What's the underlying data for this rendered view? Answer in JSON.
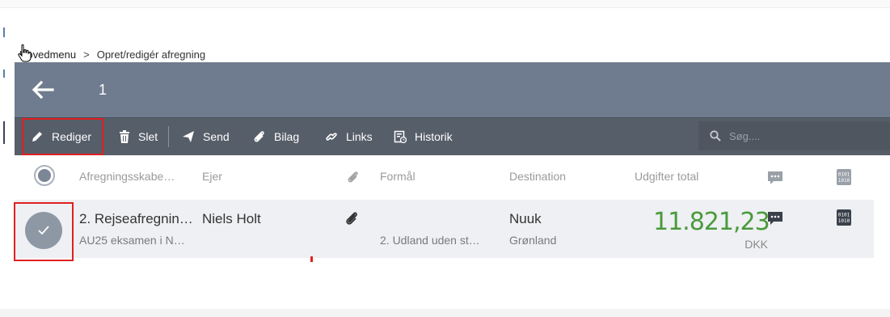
{
  "breadcrumb": {
    "home": "Hovedmenu",
    "separator": ">",
    "current": "Opret/redigér afregning"
  },
  "header": {
    "title": "1",
    "back_icon": "arrow-left-icon"
  },
  "toolbar": {
    "edit_label": "Rediger",
    "delete_label": "Slet",
    "send_label": "Send",
    "attachments_label": "Bilag",
    "links_label": "Links",
    "history_label": "Historik",
    "search_placeholder": "Søg...."
  },
  "columns": {
    "template": "Afregningsskabe…",
    "owner": "Ejer",
    "purpose": "Formål",
    "destination": "Destination",
    "total": "Udgifter total"
  },
  "row": {
    "name": "2. Rejseafregnin…",
    "subtitle": "AU25 eksamen i N…",
    "owner": "Niels Holt",
    "purpose": "2. Udland uden st…",
    "destination_city": "Nuuk",
    "destination_country": "Grønland",
    "amount": "11.821,23",
    "currency": "DKK"
  },
  "colors": {
    "header_bg": "#6f7b8e",
    "toolbar_bg": "#565e69",
    "amount_green": "#4a9a3c",
    "highlight_red": "#e02020"
  }
}
